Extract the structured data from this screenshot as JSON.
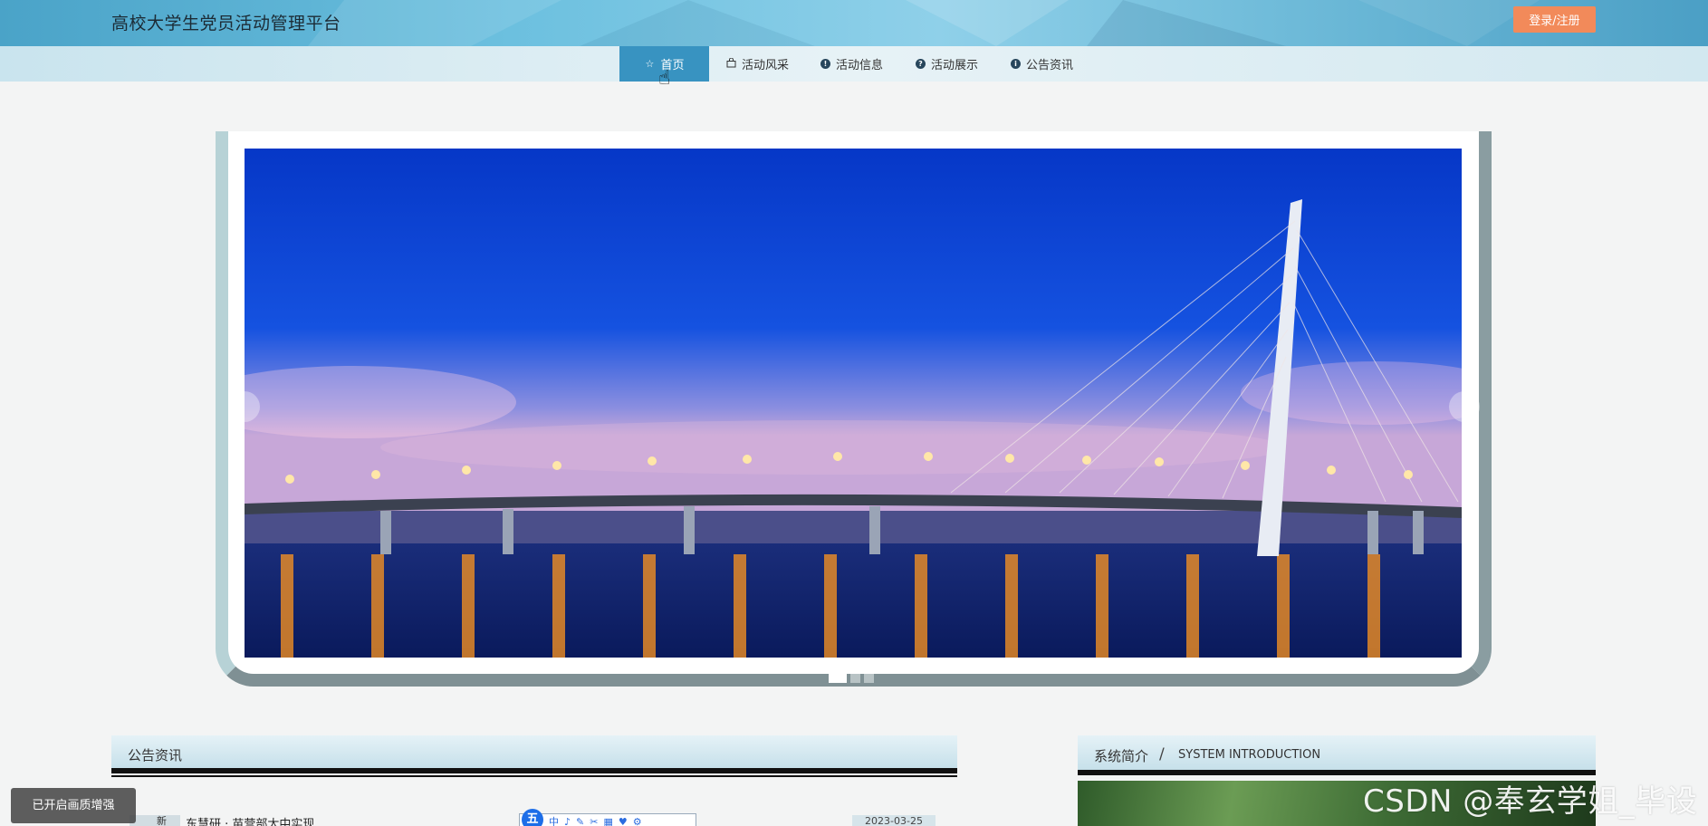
{
  "header": {
    "site_title": "高校大学生党员活动管理平台",
    "login_label": "登录/注册"
  },
  "nav": {
    "items": [
      {
        "label": "首页",
        "icon": "star-icon"
      },
      {
        "label": "活动风采",
        "icon": "bag-icon"
      },
      {
        "label": "活动信息",
        "icon": "info-icon"
      },
      {
        "label": "活动展示",
        "icon": "question-icon"
      },
      {
        "label": "公告资讯",
        "icon": "info-icon"
      }
    ],
    "active_index": 0
  },
  "banner": {
    "slide_count": 3,
    "active_slide": 0
  },
  "news": {
    "title": "公告资讯",
    "badge": "新",
    "item_text": "东慧研 · 苗营部太中实现",
    "item_date": "2023-03-25"
  },
  "intro": {
    "title": "系统简介",
    "separator": "/",
    "subtitle": "SYSTEM INTRODUCTION"
  },
  "overlay": {
    "watermark": "CSDN @奉玄学姐_毕设",
    "enhance_label": "已开启画质增强"
  },
  "colors": {
    "header": "#5fb3d6",
    "nav_active": "#3893c1",
    "login_button": "#f28a5a"
  }
}
